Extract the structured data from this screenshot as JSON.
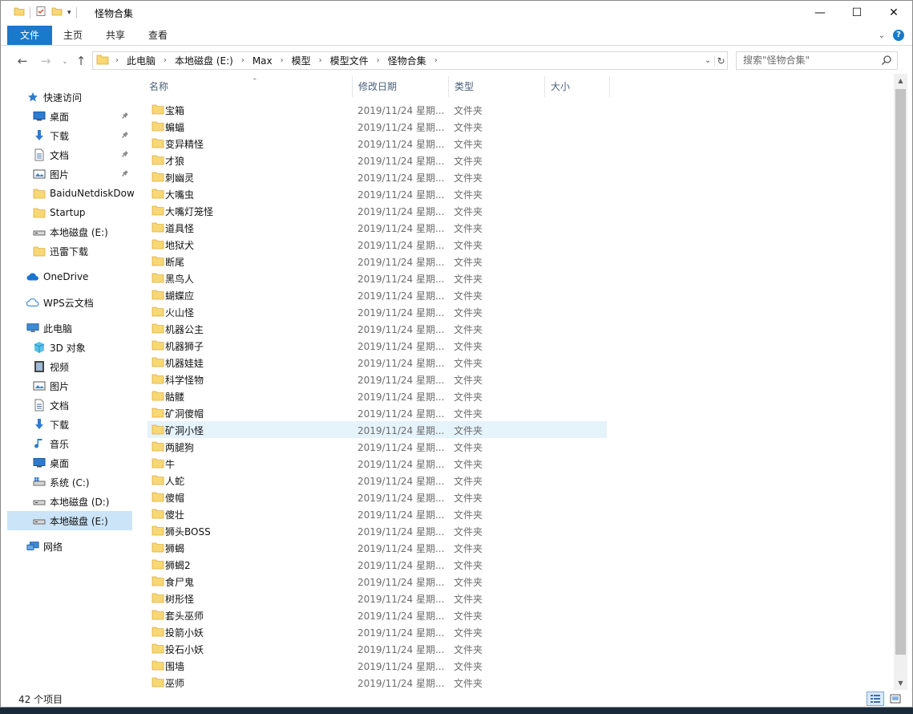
{
  "window": {
    "title": "怪物合集"
  },
  "titlebar": {
    "minimize": "—",
    "maximize": "☐",
    "close": "✕"
  },
  "ribbon": {
    "tabs": [
      "文件",
      "主页",
      "共享",
      "查看"
    ]
  },
  "address": {
    "crumbs": [
      "此电脑",
      "本地磁盘 (E:)",
      "Max",
      "模型",
      "模型文件",
      "怪物合集"
    ],
    "search_placeholder": "搜索\"怪物合集\""
  },
  "sidebar": {
    "items": [
      {
        "label": "快速访问",
        "icon": "star-icon",
        "level": 0
      },
      {
        "label": "桌面",
        "icon": "desktop-icon",
        "level": 1,
        "pinned": true
      },
      {
        "label": "下载",
        "icon": "download-icon",
        "level": 1,
        "pinned": true
      },
      {
        "label": "文档",
        "icon": "document-icon",
        "level": 1,
        "pinned": true
      },
      {
        "label": "图片",
        "icon": "pictures-icon",
        "level": 1,
        "pinned": true
      },
      {
        "label": "BaiduNetdiskDow",
        "icon": "folder-icon",
        "level": 1
      },
      {
        "label": "Startup",
        "icon": "folder-icon",
        "level": 1
      },
      {
        "label": "本地磁盘 (E:)",
        "icon": "drive-icon",
        "level": 1
      },
      {
        "label": "迅雷下载",
        "icon": "folder-icon",
        "level": 1
      },
      {
        "label": "OneDrive",
        "icon": "cloud-icon",
        "level": 0
      },
      {
        "label": "WPS云文档",
        "icon": "cloud-outline-icon",
        "level": 0
      },
      {
        "label": "此电脑",
        "icon": "computer-icon",
        "level": 0
      },
      {
        "label": "3D 对象",
        "icon": "cube-icon",
        "level": 1
      },
      {
        "label": "视频",
        "icon": "video-icon",
        "level": 1
      },
      {
        "label": "图片",
        "icon": "pictures-icon",
        "level": 1
      },
      {
        "label": "文档",
        "icon": "document-icon",
        "level": 1
      },
      {
        "label": "下载",
        "icon": "download-icon",
        "level": 1
      },
      {
        "label": "音乐",
        "icon": "music-icon",
        "level": 1
      },
      {
        "label": "桌面",
        "icon": "desktop-icon",
        "level": 1
      },
      {
        "label": "系统 (C:)",
        "icon": "system-drive-icon",
        "level": 1
      },
      {
        "label": "本地磁盘 (D:)",
        "icon": "drive-icon",
        "level": 1
      },
      {
        "label": "本地磁盘 (E:)",
        "icon": "drive-icon",
        "level": 1,
        "selected": true
      },
      {
        "label": "网络",
        "icon": "network-icon",
        "level": 0
      }
    ]
  },
  "columns": [
    "名称",
    "修改日期",
    "类型",
    "大小"
  ],
  "files": [
    {
      "name": "宝箱",
      "date": "2019/11/24 星期...",
      "type": "文件夹"
    },
    {
      "name": "蝙蝠",
      "date": "2019/11/24 星期...",
      "type": "文件夹"
    },
    {
      "name": "变异精怪",
      "date": "2019/11/24 星期...",
      "type": "文件夹"
    },
    {
      "name": "才狼",
      "date": "2019/11/24 星期...",
      "type": "文件夹"
    },
    {
      "name": "刺幽灵",
      "date": "2019/11/24 星期...",
      "type": "文件夹"
    },
    {
      "name": "大嘴虫",
      "date": "2019/11/24 星期...",
      "type": "文件夹"
    },
    {
      "name": "大嘴灯笼怪",
      "date": "2019/11/24 星期...",
      "type": "文件夹"
    },
    {
      "name": "道具怪",
      "date": "2019/11/24 星期...",
      "type": "文件夹"
    },
    {
      "name": "地狱犬",
      "date": "2019/11/24 星期...",
      "type": "文件夹"
    },
    {
      "name": "断尾",
      "date": "2019/11/24 星期...",
      "type": "文件夹"
    },
    {
      "name": "黑鸟人",
      "date": "2019/11/24 星期...",
      "type": "文件夹"
    },
    {
      "name": "蝴蝶应",
      "date": "2019/11/24 星期...",
      "type": "文件夹"
    },
    {
      "name": "火山怪",
      "date": "2019/11/24 星期...",
      "type": "文件夹"
    },
    {
      "name": "机器公主",
      "date": "2019/11/24 星期...",
      "type": "文件夹"
    },
    {
      "name": "机器狮子",
      "date": "2019/11/24 星期...",
      "type": "文件夹"
    },
    {
      "name": "机器娃娃",
      "date": "2019/11/24 星期...",
      "type": "文件夹"
    },
    {
      "name": "科学怪物",
      "date": "2019/11/24 星期...",
      "type": "文件夹"
    },
    {
      "name": "骷髅",
      "date": "2019/11/24 星期...",
      "type": "文件夹"
    },
    {
      "name": "矿洞傻帽",
      "date": "2019/11/24 星期...",
      "type": "文件夹"
    },
    {
      "name": "矿洞小怪",
      "date": "2019/11/24 星期...",
      "type": "文件夹",
      "hover": true
    },
    {
      "name": "两腿狗",
      "date": "2019/11/24 星期...",
      "type": "文件夹"
    },
    {
      "name": "牛",
      "date": "2019/11/24 星期...",
      "type": "文件夹"
    },
    {
      "name": "人蛇",
      "date": "2019/11/24 星期...",
      "type": "文件夹"
    },
    {
      "name": "傻帽",
      "date": "2019/11/24 星期...",
      "type": "文件夹"
    },
    {
      "name": "傻壮",
      "date": "2019/11/24 星期...",
      "type": "文件夹"
    },
    {
      "name": "狮头BOSS",
      "date": "2019/11/24 星期...",
      "type": "文件夹"
    },
    {
      "name": "狮蝎",
      "date": "2019/11/24 星期...",
      "type": "文件夹"
    },
    {
      "name": "狮蝎2",
      "date": "2019/11/24 星期...",
      "type": "文件夹"
    },
    {
      "name": "食尸鬼",
      "date": "2019/11/24 星期...",
      "type": "文件夹"
    },
    {
      "name": "树形怪",
      "date": "2019/11/24 星期...",
      "type": "文件夹"
    },
    {
      "name": "套头巫师",
      "date": "2019/11/24 星期...",
      "type": "文件夹"
    },
    {
      "name": "投箭小妖",
      "date": "2019/11/24 星期...",
      "type": "文件夹"
    },
    {
      "name": "投石小妖",
      "date": "2019/11/24 星期...",
      "type": "文件夹"
    },
    {
      "name": "围墙",
      "date": "2019/11/24 星期...",
      "type": "文件夹"
    },
    {
      "name": "巫师",
      "date": "2019/11/24 星期...",
      "type": "文件夹"
    }
  ],
  "status": {
    "count": "42 个项目"
  },
  "colors": {
    "accent": "#1979ca",
    "folder": "#f8d775",
    "hover": "#e5f3fb",
    "selected": "#cce4f7"
  }
}
